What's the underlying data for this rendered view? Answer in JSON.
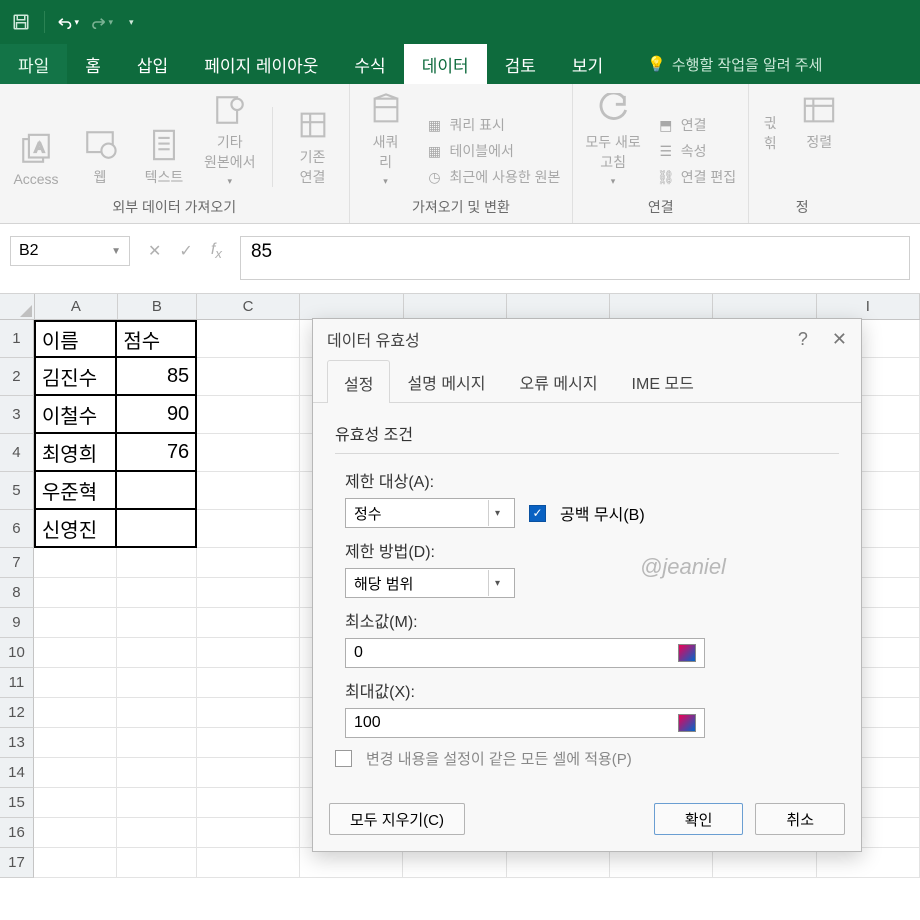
{
  "titlebar": {
    "save_icon": "save",
    "undo_icon": "undo",
    "redo_icon": "redo"
  },
  "tabs": {
    "file": "파일",
    "home": "홈",
    "insert": "삽입",
    "layout": "페이지 레이아웃",
    "formulas": "수식",
    "data": "데이터",
    "review": "검토",
    "view": "보기",
    "tell": "수행할 작업을 알려 주세"
  },
  "ribbon": {
    "group1": {
      "access": "Access",
      "web": "웹",
      "text": "텍스트",
      "other": "기타\n원본에서",
      "existing": "기존\n연결",
      "label": "외부 데이터 가져오기"
    },
    "group2": {
      "newquery": "새쿼\n리",
      "showquery": "쿼리 표시",
      "fromtable": "테이블에서",
      "recent": "최근에 사용한 원본",
      "label": "가져오기 및 변환"
    },
    "group3": {
      "refresh": "모두 새로\n고침",
      "conn": "연결",
      "prop": "속성",
      "edit": "연결 편집",
      "label": "연결"
    },
    "group4": {
      "sort_asc": "긗",
      "sort_desc": "힊",
      "sort": "정렬",
      "label": "정"
    }
  },
  "namebox": "B2",
  "formula": "85",
  "columns": [
    "A",
    "B",
    "C",
    "I"
  ],
  "sheet": {
    "headers": {
      "A": "이름",
      "B": "점수"
    },
    "rows": [
      {
        "n": 1,
        "A": "이름",
        "B": "점수"
      },
      {
        "n": 2,
        "A": "김진수",
        "B": "85"
      },
      {
        "n": 3,
        "A": "이철수",
        "B": "90"
      },
      {
        "n": 4,
        "A": "최영희",
        "B": "76"
      },
      {
        "n": 5,
        "A": "우준혁",
        "B": ""
      },
      {
        "n": 6,
        "A": "신영진",
        "B": ""
      }
    ],
    "blank_rows": [
      7,
      8,
      9,
      10,
      11,
      12,
      13,
      14,
      15,
      16,
      17
    ]
  },
  "dialog": {
    "title": "데이터 유효성",
    "tabs": {
      "settings": "설정",
      "input_msg": "설명 메시지",
      "error_msg": "오류 메시지",
      "ime": "IME 모드"
    },
    "section": "유효성 조건",
    "allow_label": "제한 대상(A):",
    "allow_value": "정수",
    "ignore_blank": "공백 무시(B)",
    "data_label": "제한 방법(D):",
    "data_value": "해당 범위",
    "min_label": "최소값(M):",
    "min_value": "0",
    "max_label": "최대값(X):",
    "max_value": "100",
    "apply_others": "변경 내용을 설정이 같은 모든 셀에 적용(P)",
    "clear_all": "모두 지우기(C)",
    "ok": "확인",
    "cancel": "취소"
  },
  "watermark": "@jeaniel"
}
